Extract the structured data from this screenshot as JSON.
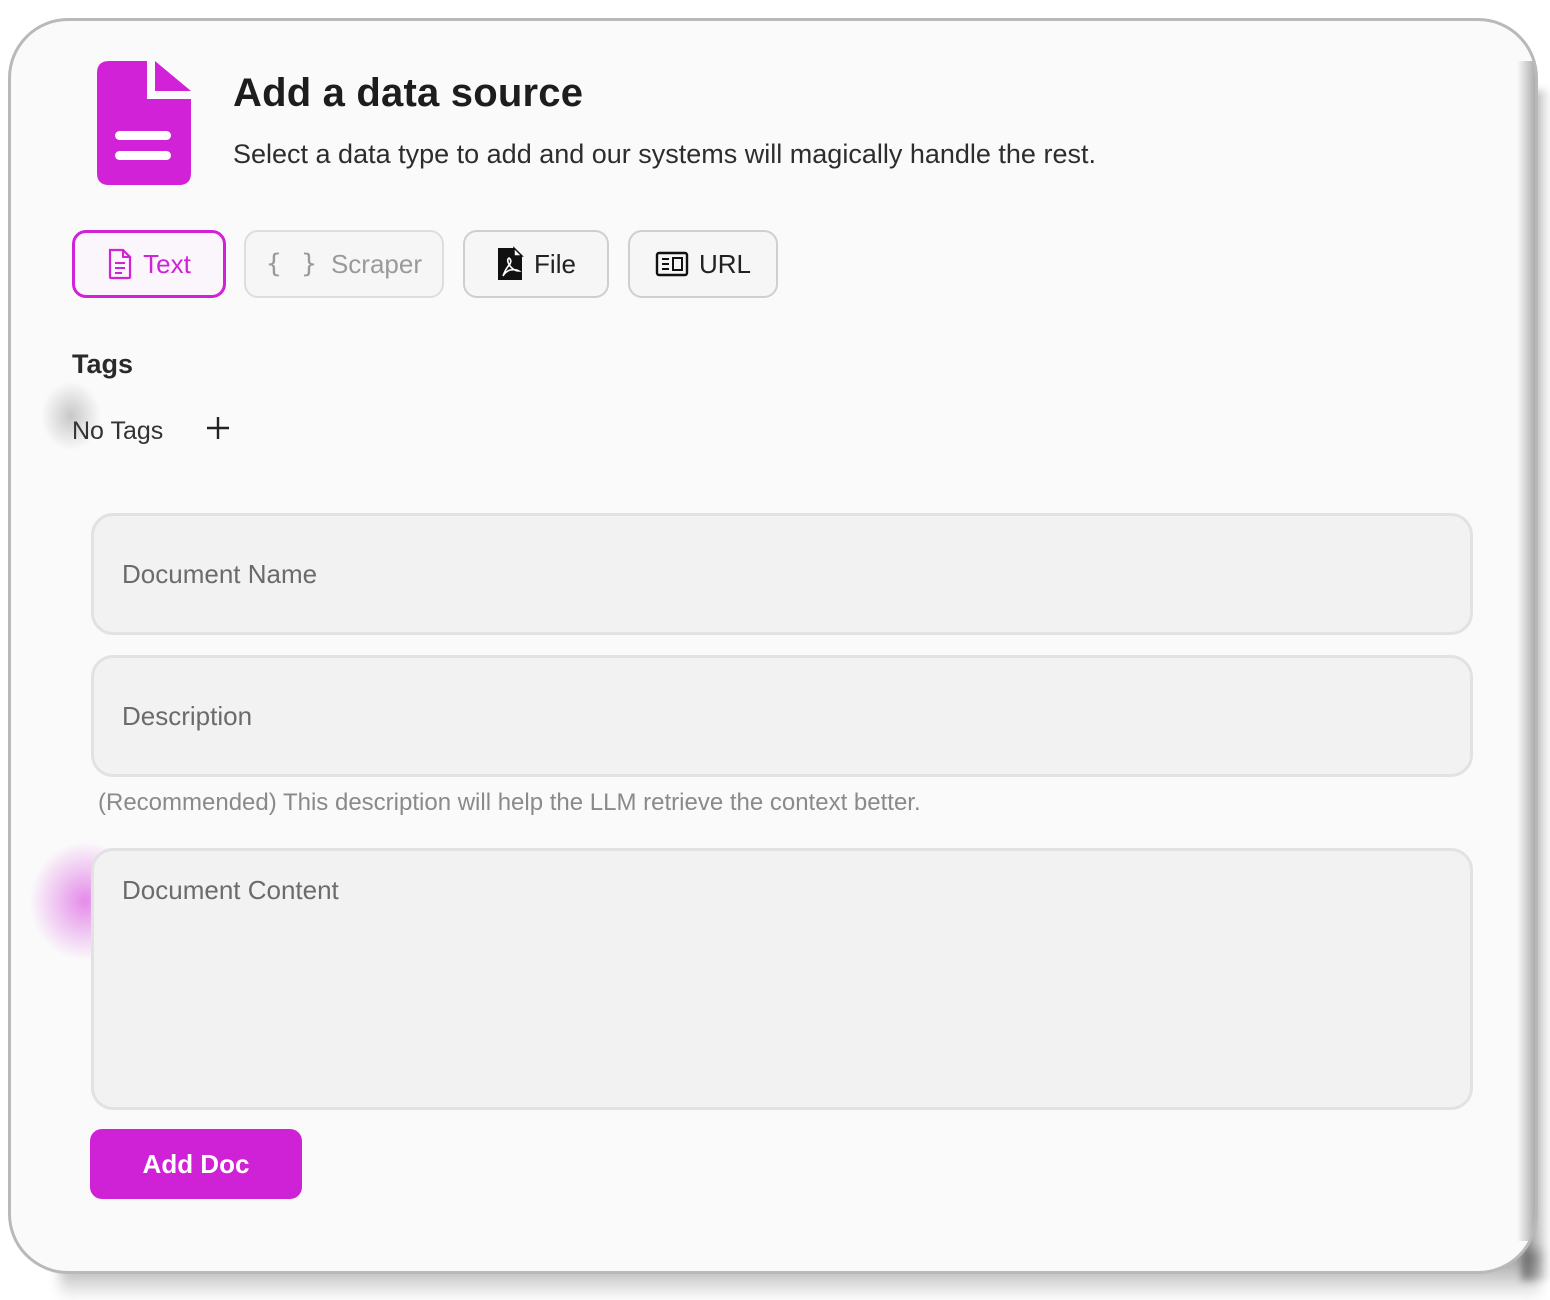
{
  "header": {
    "title": "Add a data source",
    "subtitle": "Select a data type to add and our systems will magically handle the rest.",
    "icon": "document-icon",
    "accent_color": "#d222d8"
  },
  "tabs": [
    {
      "label": "Text",
      "icon": "text-file-icon",
      "selected": true
    },
    {
      "label": "Scraper",
      "icon": "braces-icon",
      "selected": false,
      "disabled": true,
      "braces": "{ }"
    },
    {
      "label": "File",
      "icon": "pdf-file-icon",
      "selected": false
    },
    {
      "label": "URL",
      "icon": "web-page-icon",
      "selected": false
    }
  ],
  "tags": {
    "label": "Tags",
    "empty_text": "No Tags",
    "add_icon": "plus-icon"
  },
  "form": {
    "name_placeholder": "Document Name",
    "description_placeholder": "Description",
    "description_hint": "(Recommended) This description will help the LLM retrieve the context better.",
    "content_placeholder": "Document Content",
    "submit_label": "Add Doc",
    "submit_color": "#cf22d6"
  }
}
